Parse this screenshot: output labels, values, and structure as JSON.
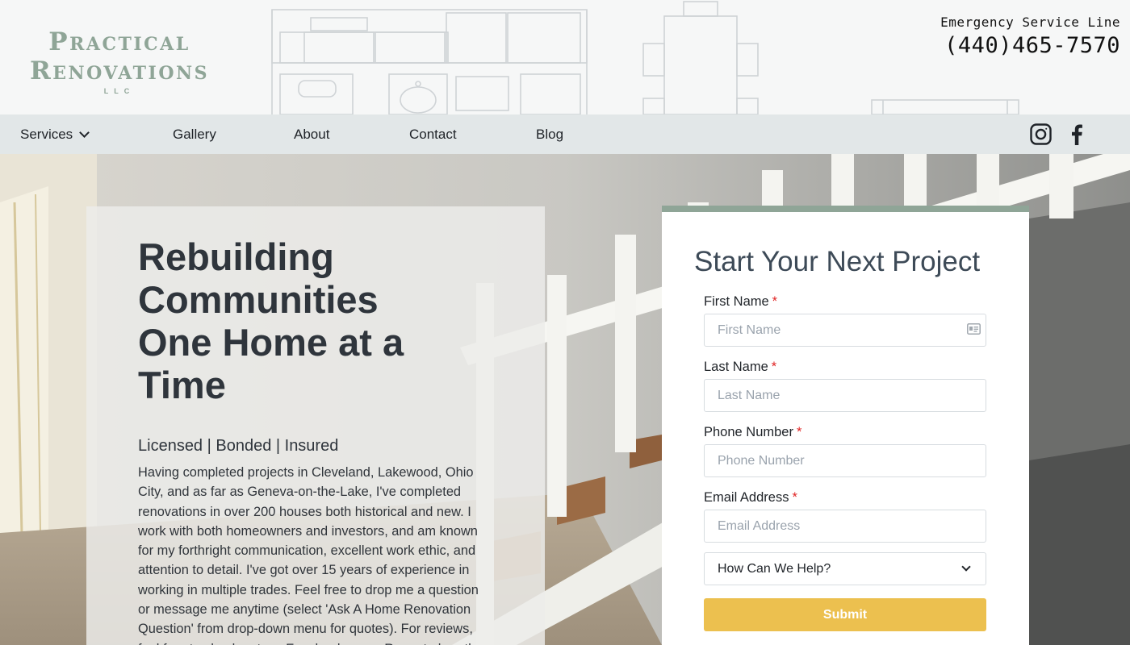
{
  "brand": {
    "logo_line1": "Practical",
    "logo_line2": "Renovations",
    "logo_suffix": "LLC"
  },
  "emergency": {
    "label": "Emergency Service Line",
    "phone": "(440)465-7570"
  },
  "nav": {
    "items": [
      {
        "label": "Services",
        "has_dropdown": true
      },
      {
        "label": "Gallery"
      },
      {
        "label": "About"
      },
      {
        "label": "Contact"
      },
      {
        "label": "Blog"
      }
    ],
    "social": [
      "instagram-icon",
      "facebook-icon"
    ]
  },
  "hero": {
    "headline": "Rebuilding Communities One Home at a Time",
    "subhead": "Licensed | Bonded | Insured",
    "body": "Having completed projects in Cleveland, Lakewood, Ohio City, and as far as Geneva-on-the-Lake, I've completed renovations in over 200 houses both historical and new. I work with both homeowners and investors, and am known for my forthright communication, excellent work ethic, and attention to detail. I've got over 15 years of experience in working in multiple trades. Feel free to drop me a question or message me anytime (select 'Ask A Home Renovation Question' from drop-down menu for quotes). For reviews, feel free to check out my Facebook page. Room to breathe"
  },
  "form": {
    "title": "Start Your Next Project",
    "required_marker": "*",
    "fields": [
      {
        "label": "First Name",
        "placeholder": "First Name",
        "value": ""
      },
      {
        "label": "Last Name",
        "placeholder": "Last Name",
        "value": ""
      },
      {
        "label": "Phone Number",
        "placeholder": "Phone Number",
        "value": ""
      },
      {
        "label": "Email Address",
        "placeholder": "Email Address",
        "value": ""
      }
    ],
    "help_select": "How Can We Help?",
    "submit_label": "Submit"
  },
  "colors": {
    "brand_sage": "#8fa597",
    "nav_bg": "#e2e7e8",
    "submit_yellow": "#ecc04f",
    "required_red": "#e02424"
  }
}
